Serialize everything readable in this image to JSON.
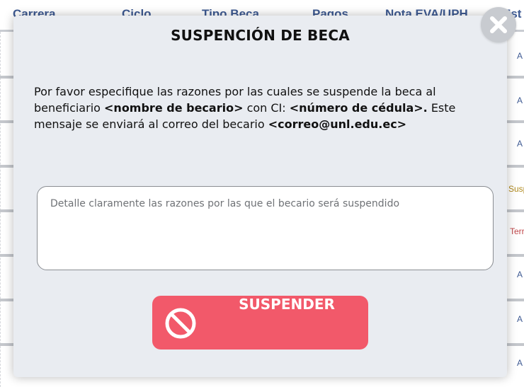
{
  "background_table": {
    "headers": [
      "Carrera",
      "Ciclo",
      "Tipo Beca",
      "Pagos",
      "Nota EVA/UPH",
      "Est"
    ],
    "row_status": [
      "A",
      "A",
      "A",
      "Susp",
      "Terr",
      "A",
      "A",
      "A"
    ]
  },
  "modal": {
    "title": "SUSPENCIÓN DE BECA",
    "message": {
      "part1": "Por favor especifique las razones por las cuales se suspende la beca al beneficiario ",
      "becario_name": "<nombre de becario>",
      "part2": " con CI: ",
      "cedula": "<número de cédula>.",
      "part3": " Este mensaje se enviará al correo del becario ",
      "email": "<correo@unl.edu.ec>"
    },
    "reason_input": {
      "placeholder": "Detalle claramente las razones por las que el becario será suspendido",
      "value": ""
    },
    "suspend_button": {
      "label": "SUSPENDER",
      "icon": "ban-icon"
    },
    "close_button": {
      "icon": "close-icon"
    }
  },
  "colors": {
    "modal_bg": "#e9ecf1",
    "accent_danger": "#f2596a",
    "header_text": "#3e5a92",
    "close_bg": "#c8cbd0"
  }
}
